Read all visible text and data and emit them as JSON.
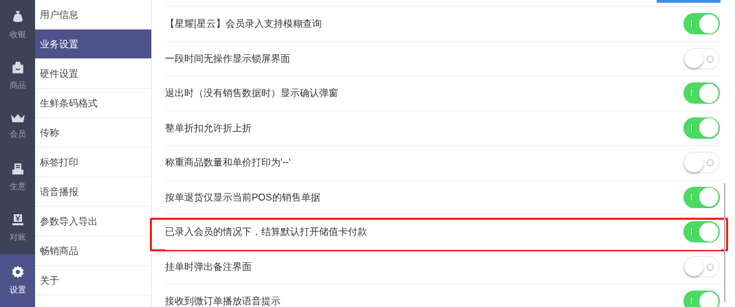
{
  "nav": [
    {
      "kind": "cashier",
      "label": "收银",
      "selected": false
    },
    {
      "kind": "goods",
      "label": "商品",
      "selected": false
    },
    {
      "kind": "member",
      "label": "会员",
      "selected": false
    },
    {
      "kind": "business",
      "label": "生意",
      "selected": false
    },
    {
      "kind": "reconcile",
      "label": "对账",
      "selected": false
    },
    {
      "kind": "settings",
      "label": "设置",
      "selected": true
    }
  ],
  "submenu": [
    {
      "label": "用户信息",
      "selected": false
    },
    {
      "label": "业务设置",
      "selected": true
    },
    {
      "label": "硬件设置",
      "selected": false
    },
    {
      "label": "生鲜条码格式",
      "selected": false
    },
    {
      "label": "传称",
      "selected": false
    },
    {
      "label": "标签打印",
      "selected": false
    },
    {
      "label": "语音播报",
      "selected": false
    },
    {
      "label": "参数导入导出",
      "selected": false
    },
    {
      "label": "畅销商品",
      "selected": false
    },
    {
      "label": "关于",
      "selected": false
    }
  ],
  "settings": [
    {
      "label": "【星耀|星云】会员录入支持模糊查询",
      "on": true,
      "highlighted": false
    },
    {
      "label": "一段时间无操作显示锁屏界面",
      "on": false,
      "highlighted": false
    },
    {
      "label": "退出时（没有销售数据时）显示确认弹窗",
      "on": true,
      "highlighted": false
    },
    {
      "label": "整单折扣允许折上折",
      "on": true,
      "highlighted": false
    },
    {
      "label": "称重商品数量和单价打印为'--'",
      "on": false,
      "highlighted": false
    },
    {
      "label": "按单退货仅显示当前POS的销售单据",
      "on": true,
      "highlighted": false
    },
    {
      "label": "已录入会员的情况下，结算默认打开储值卡付款",
      "on": true,
      "highlighted": true
    },
    {
      "label": "挂单时弹出备注界面",
      "on": false,
      "highlighted": false
    },
    {
      "label": "接收到微订单播放语音提示",
      "on": true,
      "highlighted": false
    }
  ]
}
